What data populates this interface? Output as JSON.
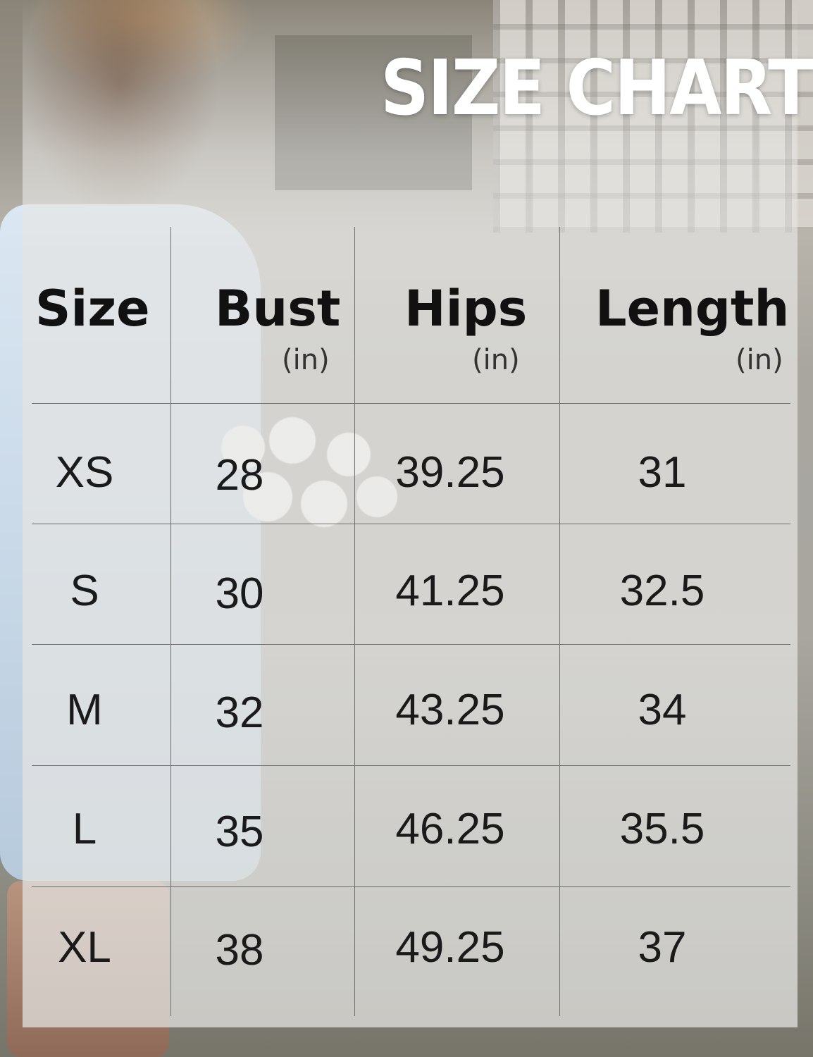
{
  "title": "SIZE CHART",
  "headers": [
    {
      "label": "Size",
      "unit": ""
    },
    {
      "label": "Bust",
      "unit": "(in)"
    },
    {
      "label": "Hips",
      "unit": "(in)"
    },
    {
      "label": "Length",
      "unit": "(in)"
    }
  ],
  "rows": [
    [
      "XS",
      "28",
      "39.25",
      "31"
    ],
    [
      "S",
      "30",
      "41.25",
      "32.5"
    ],
    [
      "M",
      "32",
      "43.25",
      "34"
    ],
    [
      "L",
      "35",
      "46.25",
      "35.5"
    ],
    [
      "XL",
      "38",
      "49.25",
      "37"
    ]
  ],
  "colors": {
    "title": "#ffffff",
    "text": "#111111",
    "grid": "#6d6d6d"
  }
}
